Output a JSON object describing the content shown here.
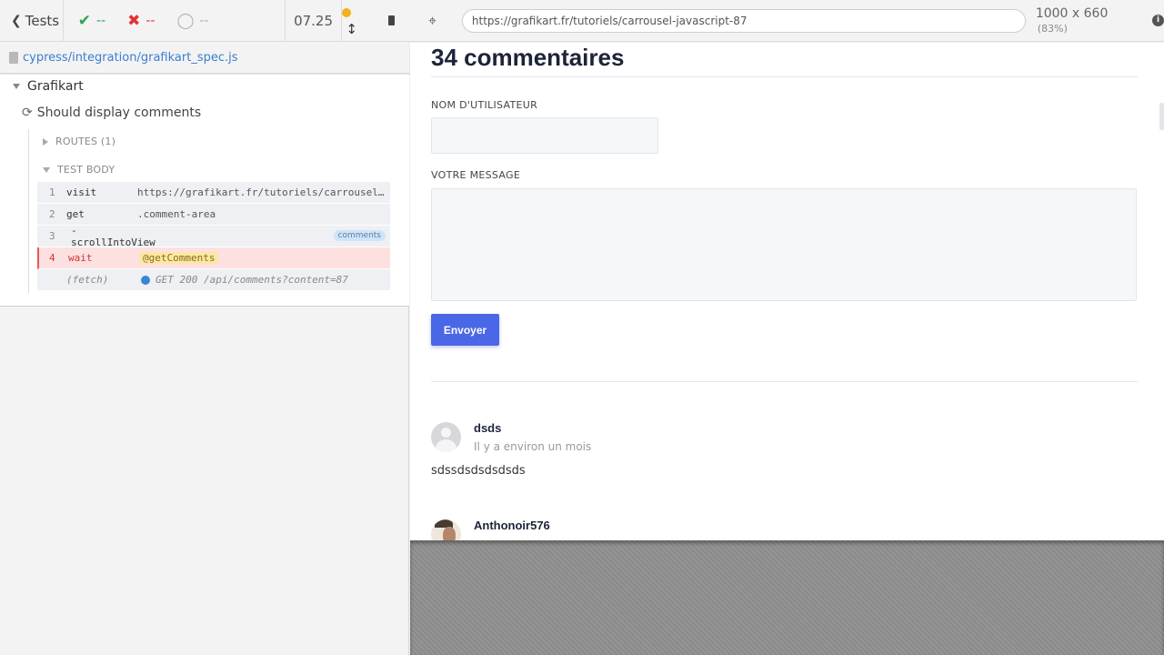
{
  "reporter": {
    "back_label": "Tests",
    "stats": {
      "passed": "--",
      "failed": "--",
      "pending": "--"
    },
    "duration": "07.25",
    "spec_path": "cypress/integration/grafikart_spec.js",
    "suite_title": "Grafikart",
    "test_title": "Should display comments",
    "routes_label": "ROUTES (1)",
    "body_label": "TEST BODY",
    "commands": [
      {
        "num": "1",
        "name": "visit",
        "message": "https://grafikart.fr/tutoriels/carrousel-javascript-87"
      },
      {
        "num": "2",
        "name": "get",
        "message": ".comment-area"
      },
      {
        "num": "3",
        "name": "-scrollIntoView",
        "message": "",
        "alias": "comments"
      },
      {
        "num": "4",
        "name": "wait",
        "message": "@getComments"
      },
      {
        "num": "",
        "name": "(fetch)",
        "message": "GET 200 /api/comments?content=87"
      }
    ]
  },
  "aut_header": {
    "url": "https://grafikart.fr/tutoriels/carrousel-javascript-87",
    "viewport": "1000 x 660",
    "scale": "(83%)"
  },
  "page": {
    "heading": "34 commentaires",
    "username_label": "NOM D'UTILISATEUR",
    "message_label": "VOTRE MESSAGE",
    "submit_label": "Envoyer",
    "comments": [
      {
        "author": "dsds",
        "date": "Il y a environ un mois",
        "body": "sdssdsdsdsdsds"
      },
      {
        "author": "Anthonoir576",
        "date": "",
        "body": ""
      }
    ]
  },
  "colors": {
    "pass": "#2ea44f",
    "fail": "#e13434",
    "running": "#f2b01e",
    "link": "#3a7ed0",
    "primary_button": "#4a67e8"
  }
}
